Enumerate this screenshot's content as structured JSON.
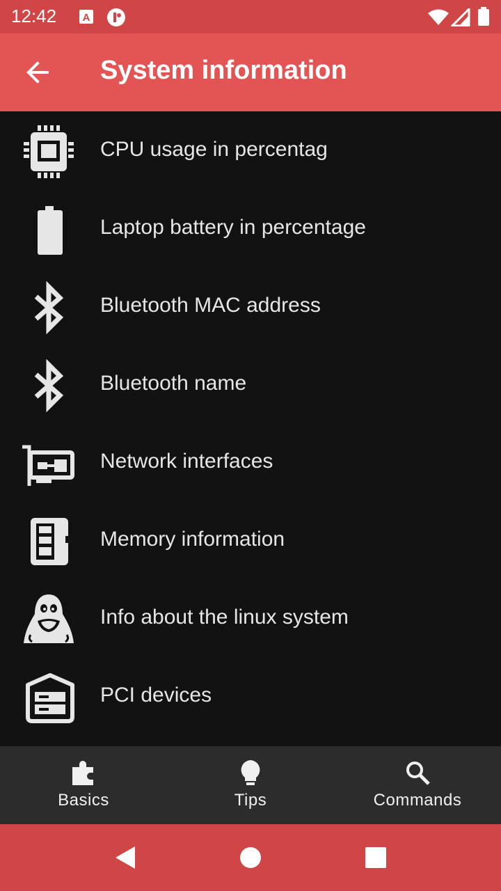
{
  "status_bar": {
    "time": "12:42",
    "icons": [
      "text-a-icon",
      "clipboard-icon",
      "wifi-icon",
      "signal-icon",
      "battery-icon"
    ]
  },
  "app_bar": {
    "title": "System information",
    "back_icon": "arrow-back-icon"
  },
  "list": {
    "items": [
      {
        "label": "CPU usage in percentag",
        "icon": "cpu-icon"
      },
      {
        "label": "Laptop battery in percentage",
        "icon": "battery-icon"
      },
      {
        "label": "Bluetooth MAC address",
        "icon": "bluetooth-icon"
      },
      {
        "label": "Bluetooth name",
        "icon": "bluetooth-icon"
      },
      {
        "label": "Network interfaces",
        "icon": "network-card-icon"
      },
      {
        "label": "Memory information",
        "icon": "memory-icon"
      },
      {
        "label": "Info about the linux system",
        "icon": "linux-tux-icon"
      },
      {
        "label": "PCI devices",
        "icon": "pci-device-icon"
      }
    ]
  },
  "bottom_nav": {
    "tabs": [
      {
        "label": "Basics",
        "icon": "puzzle-icon"
      },
      {
        "label": "Tips",
        "icon": "lightbulb-icon"
      },
      {
        "label": "Commands",
        "icon": "search-icon"
      }
    ]
  },
  "nav_bar": {
    "buttons": [
      "back-triangle-icon",
      "home-circle-icon",
      "recents-square-icon"
    ]
  },
  "colors": {
    "status_bar": "#d04545",
    "app_bar": "#e35555",
    "background": "#121212",
    "bottom_nav": "#2c2c2c",
    "text": "#e6e6e6"
  }
}
